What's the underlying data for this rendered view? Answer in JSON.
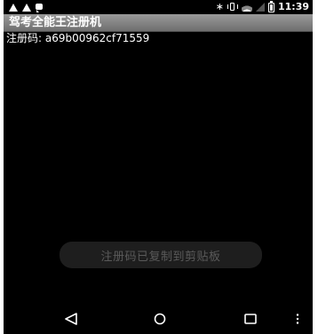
{
  "status_bar": {
    "time": "11:39",
    "left_icons": [
      "warning-icon",
      "warning-icon",
      "chat-icon"
    ],
    "right_icons": [
      "bluetooth-icon",
      "vibrate-icon",
      "wifi-icon",
      "signal-icon",
      "battery-icon"
    ],
    "bluetooth_glyph": "∗"
  },
  "title_bar": {
    "title": "驾考全能王注册机"
  },
  "content": {
    "registration_code": "注册码: a69b00962cf71559"
  },
  "toast": {
    "message": "注册码已复制到剪贴板"
  },
  "nav_bar": {
    "buttons": [
      "back-icon",
      "home-icon",
      "recents-icon",
      "menu-icon"
    ]
  },
  "colors": {
    "background": "#000000",
    "title_bar": "#8a8a8a",
    "text": "#ffffff",
    "toast_text": "#5a5a5a"
  }
}
